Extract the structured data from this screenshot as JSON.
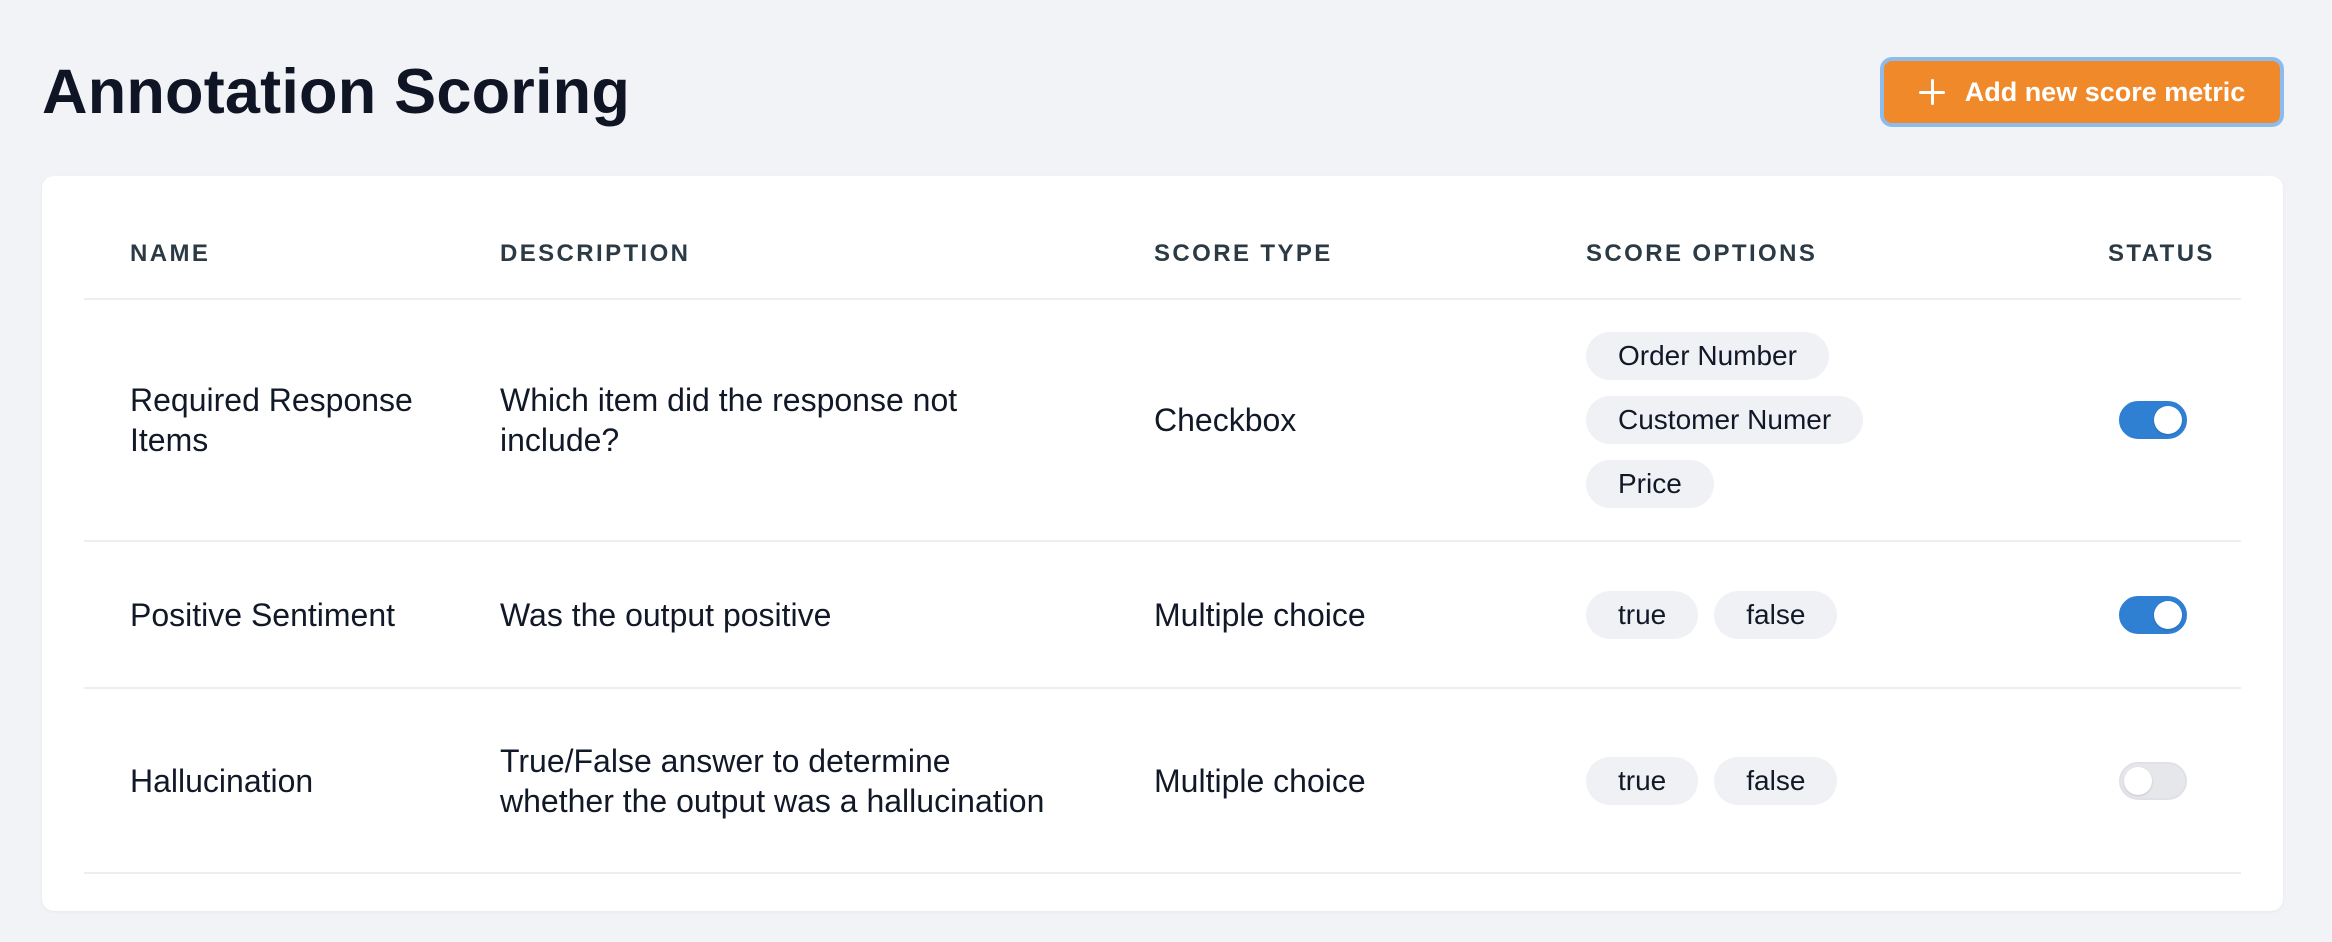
{
  "header": {
    "title": "Annotation Scoring",
    "add_button_label": "Add new score metric"
  },
  "table": {
    "columns": {
      "name": "NAME",
      "description": "DESCRIPTION",
      "score_type": "SCORE TYPE",
      "score_options": "SCORE OPTIONS",
      "status": "STATUS"
    },
    "rows": [
      {
        "name": "Required Response Items",
        "description": "Which item did the response not include?",
        "score_type": "Checkbox",
        "options": [
          "Order Number",
          "Customer Numer",
          "Price"
        ],
        "status_enabled": true
      },
      {
        "name": "Positive Sentiment",
        "description": "Was the output positive",
        "score_type": "Multiple choice",
        "options": [
          "true",
          "false"
        ],
        "status_enabled": true
      },
      {
        "name": "Hallucination",
        "description": "True/False answer to determine whether the output was a hallucination",
        "score_type": "Multiple choice",
        "options": [
          "true",
          "false"
        ],
        "status_enabled": false
      }
    ]
  },
  "colors": {
    "accent": "#f0892a",
    "toggle_on": "#2f7fd3",
    "background": "#f2f3f7"
  },
  "icons": {
    "add_button_icon": "plus-icon"
  }
}
